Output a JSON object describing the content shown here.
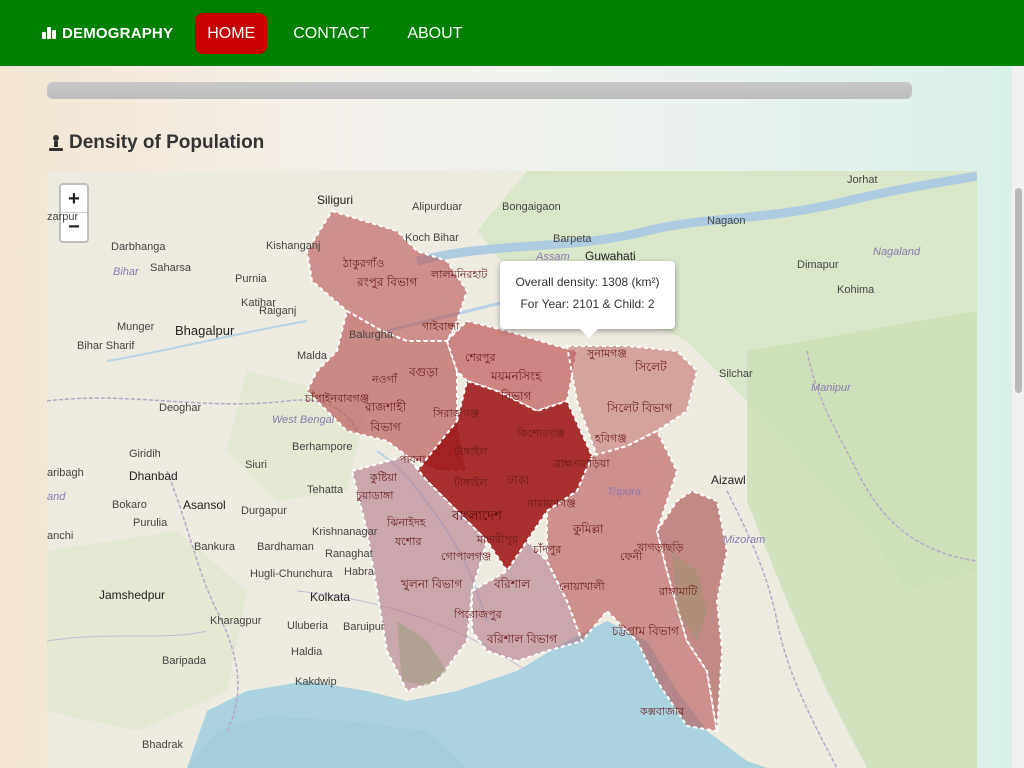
{
  "nav": {
    "brand": "DEMOGRAPHY",
    "items": [
      "HOME",
      "CONTACT",
      "ABOUT"
    ],
    "active": "HOME"
  },
  "section": {
    "title": "Density of Population"
  },
  "map": {
    "zoom_in": "+",
    "zoom_out": "−",
    "tooltip": {
      "line1": "Overall density: 1308 (km²)",
      "line2": "For Year: 2101 & Child: 2"
    },
    "labels": {
      "siliguri": "Siliguri",
      "alipurduar": "Alipurduar",
      "bongaigaon": "Bongaigaon",
      "jorhat": "Jorhat",
      "nagaon": "Nagaon",
      "guwahati": "Guwahati",
      "barpeta": "Barpeta",
      "kochbihar": "Koch Bihar",
      "darbhanga": "Darbhanga",
      "kishanganj": "Kishanganj",
      "saharsa": "Saharsa",
      "bihar": "Bihar",
      "purnia": "Purnia",
      "katihar": "Katihar",
      "raiganj": "Raiganj",
      "munger": "Munger",
      "bhagalpur": "Bhagalpur",
      "biharsharif": "Bihar Sharif",
      "balurghat": "Balurgha",
      "malda": "Malda",
      "deoghar": "Deoghar",
      "westbengal": "West Bengal",
      "berhampore": "Berhampore",
      "giridih": "Giridih",
      "dhanbad": "Dhanbad",
      "siuri": "Siuri",
      "tehatta": "Tehatta",
      "bokaro": "Bokaro",
      "asansol": "Asansol",
      "durgapur": "Durgapur",
      "purulia": "Purulia",
      "ranchi": "anchi",
      "krishnanagar": "Krishnanagar",
      "bankura": "Bankura",
      "bardhaman": "Bardhaman",
      "ranaghat": "Ranaghat",
      "hugli": "Hugli-Chunchura",
      "habra": "Habra",
      "jamshedpur": "Jamshedpur",
      "kolkata": "Kolkata",
      "kharagpur": "Kharagpur",
      "uluberia": "Uluberia",
      "baruipur": "Baruipur",
      "haldia": "Haldia",
      "baripada": "Baripada",
      "kakdwip": "Kakdwip",
      "bhadrak": "Bhadrak",
      "dimapur": "Dimapur",
      "nagaland": "Nagaland",
      "kohima": "Kohima",
      "silchar": "Silchar",
      "manipur": "Manipur",
      "aizawl": "Aizawl",
      "tripura": "Tripura",
      "mizoram": "Mizoram",
      "assam": "Assam",
      "saribagh": "aribagh",
      "jand": "and",
      "zarpur": "zarpur",
      "rangpur": "রংপুর বিভাগ",
      "thakurgaon": "ঠাকুরগাঁও",
      "lalmonirhat": "লালমনিরহাট",
      "gaibandha": "গাইবান্ধা",
      "naogaon": "নওগাঁ",
      "bogura": "বগুড়া",
      "chapai": "চাঁপাইনবাবগঞ্জ",
      "rajshahi": "রাজশাহী\nবিভাগ",
      "sirajganj": "সিরাজগঞ্জ",
      "pabna": "পাবনা",
      "sherpur": "শেরপুর",
      "mymensingh": "ময়মনসিংহ\nবিভাগ",
      "sunamganj": "সুনামগঞ্জ",
      "sylhet": "সিলেট",
      "sylhetdiv": "সিলেট বিভাগ",
      "kishoreganj": "কিশোরগঞ্জ",
      "habiganj": "হবিগঞ্জ",
      "tangail": "টাঙ্গাইল",
      "dhaka": "ঢাকা",
      "bangladesh": "বাংলাদেশ",
      "narayanganj": "নারায়ণগঞ্জ",
      "brahmanbaria": "ব্রাহ্মণবাড়িয়া",
      "kushtia": "কুষ্টিয়া",
      "chuadanga": "চুয়াডাঙ্গা",
      "jhenaidah": "ঝিনাইদহ",
      "jashore": "যশোর",
      "gopalganj": "গোপালগঞ্জ",
      "madaripur": "মাদারীপুর",
      "comilla": "কুমিল্লা",
      "feni": "ফেনী",
      "khagrachari": "খাগড়াছড়ি",
      "khulnadiv": "খুলনা বিভাগ",
      "barishal": "বরিশাল",
      "noakhali": "নোয়াখালী",
      "rangamati": "রাঙ্গামাটি",
      "pirojpur": "পিরোজপুর",
      "barishaldiv": "বরিশাল বিভাগ",
      "chattogramdiv": "চট্টগ্রাম বিভাগ",
      "coxsbazar": "কক্সবাজার",
      "chandpur": "চাঁদপুর",
      "lakshmipur": "লক্ষ্মীপুর"
    }
  },
  "colors": {
    "nav_bg": "#008000",
    "nav_active": "#c80000",
    "dhaka_fill": "#9b1111",
    "division_fill": "#b85454",
    "light_division_fill": "#b07a8a"
  }
}
